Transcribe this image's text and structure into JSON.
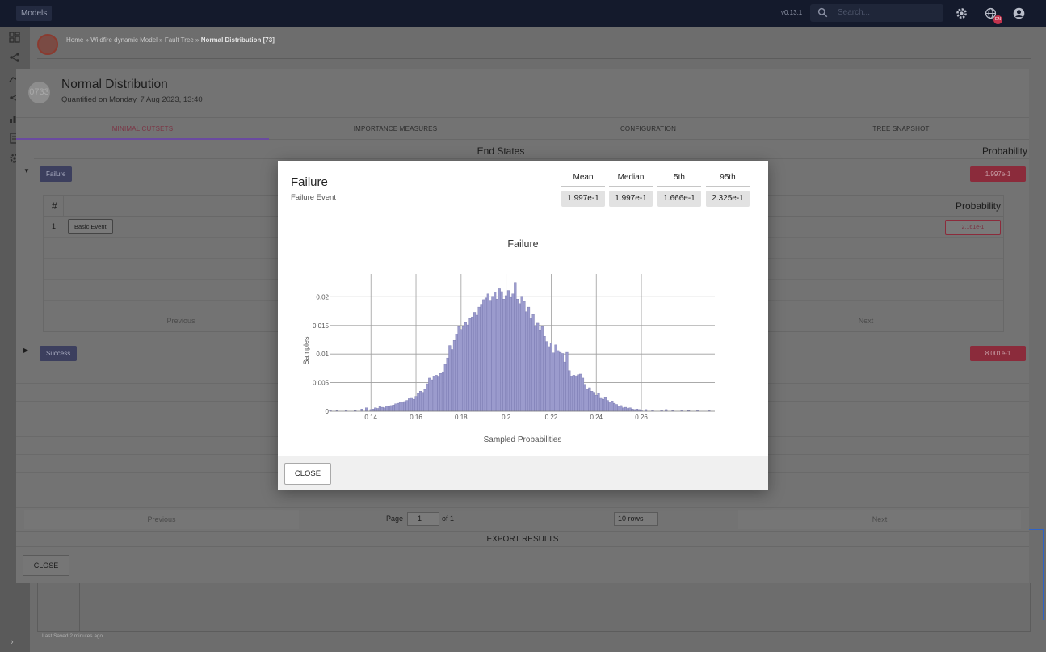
{
  "topbar": {
    "models_label": "Models",
    "version": "v0.13.1",
    "search_placeholder": "Search...",
    "language_badge": "EN"
  },
  "breadcrumb": {
    "path": "Home » Wildfire dynamic Model » Fault Tree » ",
    "current": "Normal Distribution [73]"
  },
  "footer": {
    "last_saved": "Last Saved 2 minutes ago"
  },
  "quantification": {
    "avatar": "0733",
    "title": "Normal Distribution",
    "subtitle": "Quantified on Monday, 7 Aug 2023, 13:40",
    "tabs": [
      {
        "label": "MINIMAL CUTSETS"
      },
      {
        "label": "IMPORTANCE MEASURES"
      },
      {
        "label": "CONFIGURATION"
      },
      {
        "label": "TREE SNAPSHOT"
      }
    ],
    "end_states_header": "End States",
    "probability_header": "Probability",
    "states": [
      {
        "label": "Failure",
        "probability": "1.997e-1"
      },
      {
        "label": "Success",
        "probability": "8.001e-1"
      }
    ],
    "cutsets_table": {
      "hash_header": "#",
      "probability_header": "Probability",
      "rows": [
        {
          "index": "1",
          "event": "Basic Event",
          "probability": "2.161e-1"
        }
      ],
      "previous": "Previous",
      "next": "Next"
    },
    "pager": {
      "previous": "Previous",
      "next": "Next",
      "page_label": "Page",
      "page_value": "1",
      "of_label": "of 1",
      "rows_label": "10 rows"
    },
    "export_label": "EXPORT RESULTS",
    "close_label": "CLOSE"
  },
  "dialog": {
    "title": "Failure",
    "subtitle": "Failure Event",
    "stats": [
      {
        "label": "Mean",
        "value": "1.997e-1"
      },
      {
        "label": "Median",
        "value": "1.997e-1"
      },
      {
        "label": "5th",
        "value": "1.666e-1"
      },
      {
        "label": "95th",
        "value": "2.325e-1"
      }
    ],
    "close_label": "CLOSE"
  },
  "chart_data": {
    "type": "bar",
    "title": "Failure",
    "xlabel": "Sampled Probabilities",
    "ylabel": "Samples",
    "xlim": [
      0.122,
      0.2926
    ],
    "ylim": [
      0,
      0.024
    ],
    "x_ticks": [
      0.14,
      0.16,
      0.18,
      0.2,
      0.22,
      0.24,
      0.26
    ],
    "x_tick_labels": [
      "0.14",
      "0.16",
      "0.18",
      "0.2",
      "0.22",
      "0.24",
      "0.26"
    ],
    "y_ticks": [
      0,
      0.005,
      0.01,
      0.015,
      0.02
    ],
    "y_tick_labels": [
      "0",
      "0.005",
      "0.01",
      "0.015",
      "0.02"
    ],
    "grid": true,
    "bar_color": "#9b9bcd",
    "bar_edge_color": "#6f6fa8",
    "bin_width": 0.001,
    "bins": [
      {
        "x": 0.122,
        "y": 0.0002
      },
      {
        "x": 0.125,
        "y": 0.0001
      },
      {
        "x": 0.129,
        "y": 0.0002
      },
      {
        "x": 0.133,
        "y": 0.0001
      },
      {
        "x": 0.136,
        "y": 0.0004
      },
      {
        "x": 0.138,
        "y": 0.0006
      },
      {
        "x": 0.14,
        "y": 0.0003
      },
      {
        "x": 0.141,
        "y": 0.0004
      },
      {
        "x": 0.142,
        "y": 0.0006
      },
      {
        "x": 0.143,
        "y": 0.0005
      },
      {
        "x": 0.144,
        "y": 0.0008
      },
      {
        "x": 0.145,
        "y": 0.0007
      },
      {
        "x": 0.146,
        "y": 0.0006
      },
      {
        "x": 0.147,
        "y": 0.0009
      },
      {
        "x": 0.148,
        "y": 0.0008
      },
      {
        "x": 0.149,
        "y": 0.001
      },
      {
        "x": 0.15,
        "y": 0.0011
      },
      {
        "x": 0.151,
        "y": 0.0013
      },
      {
        "x": 0.152,
        "y": 0.0014
      },
      {
        "x": 0.153,
        "y": 0.0016
      },
      {
        "x": 0.154,
        "y": 0.0015
      },
      {
        "x": 0.155,
        "y": 0.0017
      },
      {
        "x": 0.156,
        "y": 0.0019
      },
      {
        "x": 0.157,
        "y": 0.0022
      },
      {
        "x": 0.158,
        "y": 0.0024
      },
      {
        "x": 0.159,
        "y": 0.0021
      },
      {
        "x": 0.16,
        "y": 0.0026
      },
      {
        "x": 0.161,
        "y": 0.0031
      },
      {
        "x": 0.162,
        "y": 0.0035
      },
      {
        "x": 0.163,
        "y": 0.0033
      },
      {
        "x": 0.164,
        "y": 0.0038
      },
      {
        "x": 0.165,
        "y": 0.0048
      },
      {
        "x": 0.166,
        "y": 0.0058
      },
      {
        "x": 0.167,
        "y": 0.0055
      },
      {
        "x": 0.168,
        "y": 0.0061
      },
      {
        "x": 0.169,
        "y": 0.0063
      },
      {
        "x": 0.17,
        "y": 0.006
      },
      {
        "x": 0.171,
        "y": 0.0066
      },
      {
        "x": 0.172,
        "y": 0.0069
      },
      {
        "x": 0.173,
        "y": 0.0082
      },
      {
        "x": 0.174,
        "y": 0.0093
      },
      {
        "x": 0.175,
        "y": 0.0115
      },
      {
        "x": 0.176,
        "y": 0.0108
      },
      {
        "x": 0.177,
        "y": 0.0124
      },
      {
        "x": 0.178,
        "y": 0.0135
      },
      {
        "x": 0.179,
        "y": 0.0148
      },
      {
        "x": 0.18,
        "y": 0.0143
      },
      {
        "x": 0.181,
        "y": 0.0148
      },
      {
        "x": 0.182,
        "y": 0.0155
      },
      {
        "x": 0.183,
        "y": 0.0151
      },
      {
        "x": 0.184,
        "y": 0.0162
      },
      {
        "x": 0.185,
        "y": 0.0165
      },
      {
        "x": 0.186,
        "y": 0.0173
      },
      {
        "x": 0.187,
        "y": 0.0168
      },
      {
        "x": 0.188,
        "y": 0.0182
      },
      {
        "x": 0.189,
        "y": 0.0187
      },
      {
        "x": 0.19,
        "y": 0.0195
      },
      {
        "x": 0.191,
        "y": 0.0198
      },
      {
        "x": 0.192,
        "y": 0.0205
      },
      {
        "x": 0.193,
        "y": 0.0194
      },
      {
        "x": 0.194,
        "y": 0.0201
      },
      {
        "x": 0.195,
        "y": 0.0208
      },
      {
        "x": 0.196,
        "y": 0.0196
      },
      {
        "x": 0.197,
        "y": 0.0214
      },
      {
        "x": 0.198,
        "y": 0.0209
      },
      {
        "x": 0.199,
        "y": 0.0196
      },
      {
        "x": 0.2,
        "y": 0.0202
      },
      {
        "x": 0.201,
        "y": 0.0211
      },
      {
        "x": 0.202,
        "y": 0.0199
      },
      {
        "x": 0.203,
        "y": 0.0205
      },
      {
        "x": 0.204,
        "y": 0.0225
      },
      {
        "x": 0.205,
        "y": 0.0196
      },
      {
        "x": 0.206,
        "y": 0.0188
      },
      {
        "x": 0.207,
        "y": 0.0201
      },
      {
        "x": 0.208,
        "y": 0.0192
      },
      {
        "x": 0.209,
        "y": 0.0174
      },
      {
        "x": 0.21,
        "y": 0.0182
      },
      {
        "x": 0.211,
        "y": 0.0163
      },
      {
        "x": 0.212,
        "y": 0.0169
      },
      {
        "x": 0.213,
        "y": 0.0149
      },
      {
        "x": 0.214,
        "y": 0.0154
      },
      {
        "x": 0.215,
        "y": 0.0141
      },
      {
        "x": 0.216,
        "y": 0.0148
      },
      {
        "x": 0.217,
        "y": 0.0131
      },
      {
        "x": 0.218,
        "y": 0.0122
      },
      {
        "x": 0.219,
        "y": 0.0113
      },
      {
        "x": 0.22,
        "y": 0.0119
      },
      {
        "x": 0.221,
        "y": 0.0102
      },
      {
        "x": 0.222,
        "y": 0.0116
      },
      {
        "x": 0.223,
        "y": 0.0106
      },
      {
        "x": 0.224,
        "y": 0.0103
      },
      {
        "x": 0.225,
        "y": 0.0101
      },
      {
        "x": 0.226,
        "y": 0.0086
      },
      {
        "x": 0.227,
        "y": 0.0103
      },
      {
        "x": 0.228,
        "y": 0.0071
      },
      {
        "x": 0.229,
        "y": 0.0061
      },
      {
        "x": 0.23,
        "y": 0.0063
      },
      {
        "x": 0.231,
        "y": 0.0062
      },
      {
        "x": 0.232,
        "y": 0.0064
      },
      {
        "x": 0.233,
        "y": 0.0065
      },
      {
        "x": 0.234,
        "y": 0.0058
      },
      {
        "x": 0.235,
        "y": 0.0047
      },
      {
        "x": 0.236,
        "y": 0.0038
      },
      {
        "x": 0.237,
        "y": 0.0041
      },
      {
        "x": 0.238,
        "y": 0.0035
      },
      {
        "x": 0.239,
        "y": 0.0033
      },
      {
        "x": 0.24,
        "y": 0.0028
      },
      {
        "x": 0.241,
        "y": 0.0031
      },
      {
        "x": 0.242,
        "y": 0.0024
      },
      {
        "x": 0.243,
        "y": 0.0021
      },
      {
        "x": 0.244,
        "y": 0.0025
      },
      {
        "x": 0.245,
        "y": 0.0019
      },
      {
        "x": 0.246,
        "y": 0.0016
      },
      {
        "x": 0.247,
        "y": 0.0018
      },
      {
        "x": 0.248,
        "y": 0.0014
      },
      {
        "x": 0.249,
        "y": 0.0012
      },
      {
        "x": 0.25,
        "y": 0.0009
      },
      {
        "x": 0.251,
        "y": 0.001
      },
      {
        "x": 0.252,
        "y": 0.0006
      },
      {
        "x": 0.253,
        "y": 0.0007
      },
      {
        "x": 0.254,
        "y": 0.0005
      },
      {
        "x": 0.255,
        "y": 0.0006
      },
      {
        "x": 0.256,
        "y": 0.0004
      },
      {
        "x": 0.257,
        "y": 0.0003
      },
      {
        "x": 0.258,
        "y": 0.0004
      },
      {
        "x": 0.259,
        "y": 0.0003
      },
      {
        "x": 0.26,
        "y": 0.0002
      },
      {
        "x": 0.262,
        "y": 0.0003
      },
      {
        "x": 0.265,
        "y": 0.0002
      },
      {
        "x": 0.269,
        "y": 0.0002
      },
      {
        "x": 0.271,
        "y": 0.0003
      },
      {
        "x": 0.274,
        "y": 0.0001
      },
      {
        "x": 0.278,
        "y": 0.0002
      },
      {
        "x": 0.281,
        "y": 0.0001
      },
      {
        "x": 0.285,
        "y": 0.0002
      },
      {
        "x": 0.29,
        "y": 0.0002
      }
    ]
  }
}
